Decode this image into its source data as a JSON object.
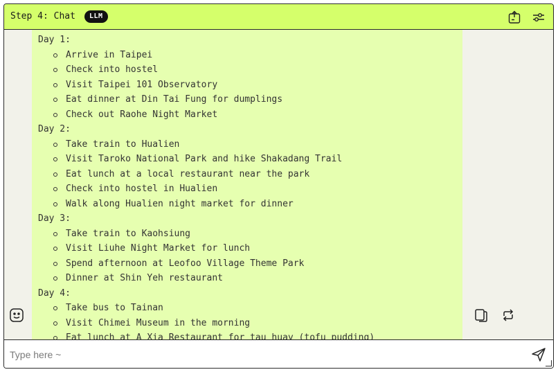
{
  "header": {
    "title": "Step 4: Chat",
    "badge": "LLM"
  },
  "chat": {
    "lines": [
      {
        "kind": "day",
        "text": "Day 1:"
      },
      {
        "kind": "item",
        "text": "Arrive in Taipei"
      },
      {
        "kind": "item",
        "text": "Check into hostel"
      },
      {
        "kind": "item",
        "text": "Visit Taipei 101 Observatory"
      },
      {
        "kind": "item",
        "text": "Eat dinner at Din Tai Fung for dumplings"
      },
      {
        "kind": "item",
        "text": "Check out Raohe Night Market"
      },
      {
        "kind": "day",
        "text": "Day 2:"
      },
      {
        "kind": "item",
        "text": "Take train to Hualien"
      },
      {
        "kind": "item",
        "text": "Visit Taroko National Park and hike Shakadang Trail"
      },
      {
        "kind": "item",
        "text": "Eat lunch at a local restaurant near the park"
      },
      {
        "kind": "item",
        "text": "Check into hostel in Hualien"
      },
      {
        "kind": "item",
        "text": "Walk along Hualien night market for dinner"
      },
      {
        "kind": "day",
        "text": "Day 3:"
      },
      {
        "kind": "item",
        "text": "Take train to Kaohsiung"
      },
      {
        "kind": "item",
        "text": "Visit Liuhe Night Market for lunch"
      },
      {
        "kind": "item",
        "text": "Spend afternoon at Leofoo Village Theme Park"
      },
      {
        "kind": "item",
        "text": "Dinner at Shin Yeh restaurant"
      },
      {
        "kind": "day",
        "text": "Day 4:"
      },
      {
        "kind": "item",
        "text": "Take bus to Tainan"
      },
      {
        "kind": "item",
        "text": "Visit Chimei Museum in the morning"
      },
      {
        "kind": "item",
        "text": "Eat lunch at A Xia Restaurant for tau huay (tofu pudding)"
      }
    ]
  },
  "input": {
    "placeholder": "Type here ~",
    "value": ""
  },
  "colors": {
    "header_bg": "#d5ff6b",
    "bubble_bg": "#e6ffb0",
    "badge_bg": "#111111"
  },
  "icons": [
    "export-icon",
    "settings-sliders-icon",
    "avatar-icon",
    "copy-icon",
    "regenerate-icon",
    "send-icon"
  ]
}
